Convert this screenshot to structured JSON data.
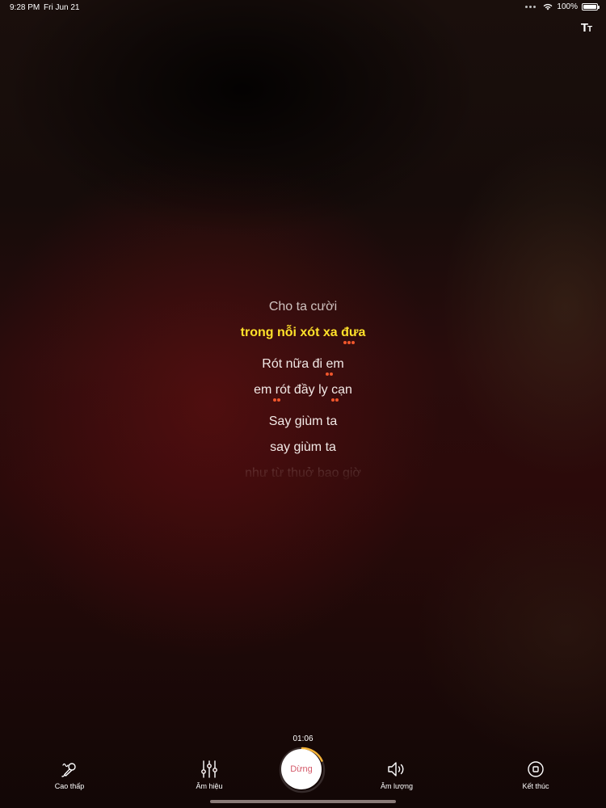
{
  "status_bar": {
    "time": "9:28 PM",
    "date": "Fri Jun 21",
    "battery": "100%"
  },
  "lyrics": [
    "Cho ta cười",
    "trong nỗi xót xa đưa",
    "Rót nữa đi em",
    "em rót đầy ly cạn",
    "Say giùm ta",
    "say giùm ta",
    "như từ thuở bao giờ"
  ],
  "player": {
    "elapsed": "01:06",
    "progress": 0.18,
    "stop_label": "Dừng"
  },
  "controls": {
    "pitch_label": "Cao thấp",
    "effects_label": "Âm hiệu",
    "volume_label": "Âm lượng",
    "end_label": "Kết thúc"
  },
  "colors": {
    "active_lyric": "#ffe12a",
    "tone_dot": "#f0562c",
    "stop_text": "#d45a6a",
    "progress_ring": "#f5b43a"
  },
  "icons": [
    "wifi-icon",
    "battery-icon",
    "font-size-icon",
    "microphone-pitch-icon",
    "equalizer-icon",
    "speaker-icon",
    "stop-circle-icon"
  ]
}
